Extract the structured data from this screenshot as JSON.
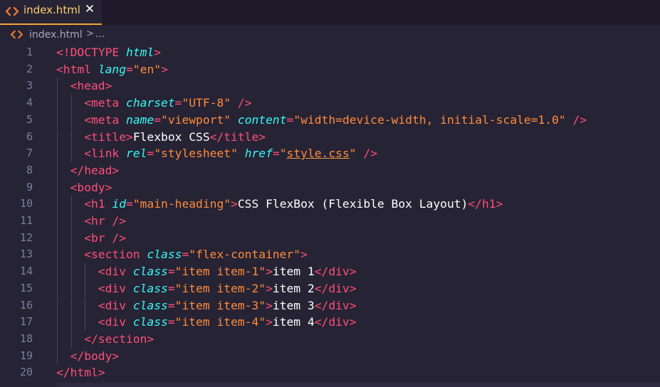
{
  "tab": {
    "label": "index.html",
    "icon": "html-code-icon",
    "close_symbol": "✕",
    "accent": "#f4a23a"
  },
  "breadcrumb": {
    "file": "index.html",
    "separator": ">",
    "more": "..."
  },
  "colors": {
    "background": "#262335",
    "tag": "#fe4f75",
    "attribute": "#36f9f6",
    "string": "#ff8b39",
    "text": "#ffffff",
    "line_number": "#7b7f9a"
  },
  "lines": [
    {
      "n": "1",
      "indent": 0,
      "tokens": [
        [
          "t",
          "<!DOCTYPE "
        ],
        [
          "kw",
          "html"
        ],
        [
          "t",
          ">"
        ]
      ]
    },
    {
      "n": "2",
      "indent": 0,
      "tokens": [
        [
          "t",
          "<html "
        ],
        [
          "a",
          "lang"
        ],
        [
          "eq",
          "="
        ],
        [
          "s",
          "\"en\""
        ],
        [
          "t",
          ">"
        ]
      ]
    },
    {
      "n": "3",
      "indent": 1,
      "tokens": [
        [
          "t",
          "<head>"
        ]
      ]
    },
    {
      "n": "4",
      "indent": 2,
      "tokens": [
        [
          "t",
          "<meta "
        ],
        [
          "a",
          "charset"
        ],
        [
          "eq",
          "="
        ],
        [
          "s",
          "\"UTF-8\""
        ],
        [
          "t",
          " />"
        ]
      ]
    },
    {
      "n": "5",
      "indent": 2,
      "tokens": [
        [
          "t",
          "<meta "
        ],
        [
          "a",
          "name"
        ],
        [
          "eq",
          "="
        ],
        [
          "s",
          "\"viewport\""
        ],
        [
          "txt",
          " "
        ],
        [
          "a",
          "content"
        ],
        [
          "eq",
          "="
        ],
        [
          "s",
          "\"width=device-width, initial-scale=1.0\""
        ],
        [
          "t",
          " />"
        ]
      ]
    },
    {
      "n": "6",
      "indent": 2,
      "tokens": [
        [
          "t",
          "<title>"
        ],
        [
          "txt",
          "Flexbox CSS"
        ],
        [
          "t",
          "</title>"
        ]
      ]
    },
    {
      "n": "7",
      "indent": 2,
      "tokens": [
        [
          "t",
          "<link "
        ],
        [
          "a",
          "rel"
        ],
        [
          "eq",
          "="
        ],
        [
          "s",
          "\"stylesheet\""
        ],
        [
          "txt",
          " "
        ],
        [
          "a",
          "href"
        ],
        [
          "eq",
          "="
        ],
        [
          "s",
          "\""
        ],
        [
          "sul",
          "style.css"
        ],
        [
          "s",
          "\""
        ],
        [
          "t",
          " />"
        ]
      ]
    },
    {
      "n": "8",
      "indent": 1,
      "tokens": [
        [
          "t",
          "</head>"
        ]
      ]
    },
    {
      "n": "9",
      "indent": 1,
      "tokens": [
        [
          "t",
          "<body>"
        ]
      ]
    },
    {
      "n": "10",
      "indent": 2,
      "tokens": [
        [
          "t",
          "<h1 "
        ],
        [
          "a",
          "id"
        ],
        [
          "eq",
          "="
        ],
        [
          "s",
          "\"main-heading\""
        ],
        [
          "t",
          ">"
        ],
        [
          "txt",
          "CSS FlexBox (Flexible Box Layout)"
        ],
        [
          "t",
          "</h1>"
        ]
      ]
    },
    {
      "n": "11",
      "indent": 2,
      "tokens": [
        [
          "t",
          "<hr />"
        ]
      ]
    },
    {
      "n": "12",
      "indent": 2,
      "tokens": [
        [
          "t",
          "<br />"
        ]
      ]
    },
    {
      "n": "13",
      "indent": 2,
      "tokens": [
        [
          "t",
          "<section "
        ],
        [
          "a",
          "class"
        ],
        [
          "eq",
          "="
        ],
        [
          "s",
          "\"flex-container\""
        ],
        [
          "t",
          ">"
        ]
      ]
    },
    {
      "n": "14",
      "indent": 3,
      "tokens": [
        [
          "t",
          "<div "
        ],
        [
          "a",
          "class"
        ],
        [
          "eq",
          "="
        ],
        [
          "s",
          "\"item item-1\""
        ],
        [
          "t",
          ">"
        ],
        [
          "txt",
          "item 1"
        ],
        [
          "t",
          "</div>"
        ]
      ]
    },
    {
      "n": "15",
      "indent": 3,
      "tokens": [
        [
          "t",
          "<div "
        ],
        [
          "a",
          "class"
        ],
        [
          "eq",
          "="
        ],
        [
          "s",
          "\"item item-2\""
        ],
        [
          "t",
          ">"
        ],
        [
          "txt",
          "item 2"
        ],
        [
          "t",
          "</div>"
        ]
      ]
    },
    {
      "n": "16",
      "indent": 3,
      "tokens": [
        [
          "t",
          "<div "
        ],
        [
          "a",
          "class"
        ],
        [
          "eq",
          "="
        ],
        [
          "s",
          "\"item item-3\""
        ],
        [
          "t",
          ">"
        ],
        [
          "txt",
          "item 3"
        ],
        [
          "t",
          "</div>"
        ]
      ]
    },
    {
      "n": "17",
      "indent": 3,
      "tokens": [
        [
          "t",
          "<div "
        ],
        [
          "a",
          "class"
        ],
        [
          "eq",
          "="
        ],
        [
          "s",
          "\"item item-4\""
        ],
        [
          "t",
          ">"
        ],
        [
          "txt",
          "item 4"
        ],
        [
          "t",
          "</div>"
        ]
      ]
    },
    {
      "n": "18",
      "indent": 2,
      "tokens": [
        [
          "t",
          "</section>"
        ]
      ]
    },
    {
      "n": "19",
      "indent": 1,
      "tokens": [
        [
          "t",
          "</body>"
        ]
      ]
    },
    {
      "n": "20",
      "indent": 0,
      "tokens": [
        [
          "t",
          "</html>"
        ]
      ]
    }
  ]
}
